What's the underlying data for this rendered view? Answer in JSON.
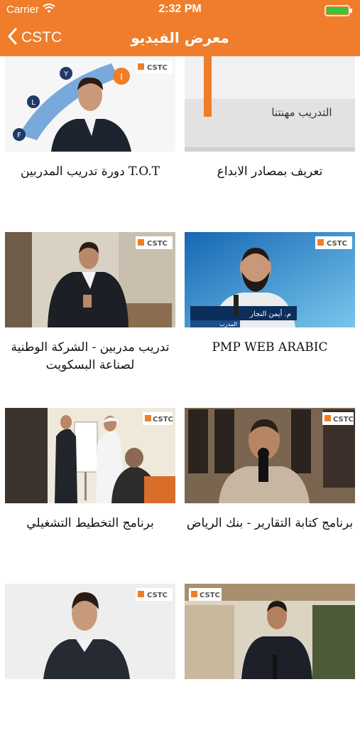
{
  "status_bar": {
    "carrier": "Carrier",
    "time": "2:32 PM"
  },
  "nav": {
    "back_label": "CSTC",
    "title": "معرض الفيديو"
  },
  "thumb_badge": "CSTC",
  "videos": [
    {
      "title": "تعريف بمصادر الابداع",
      "overlay_text": "التدريب مهنتنا"
    },
    {
      "title": "دورة تدريب المدربين T.O.T",
      "overlay_letters": [
        "F",
        "L",
        "Y",
        "I"
      ]
    },
    {
      "title": "PMP WEB ARABIC",
      "lower_third_title": "المدرب",
      "lower_third_name": "م. أيمن النجار"
    },
    {
      "title": "تدريب مدربين - الشركة الوطنية لصناعة البسكويت"
    },
    {
      "title": "برنامج كتابة التقارير - بنك الرياض"
    },
    {
      "title": "برنامج التخطيط التشغيلي"
    },
    {
      "title": ""
    },
    {
      "title": ""
    }
  ],
  "colors": {
    "accent": "#ef7d2b",
    "text": "#111111",
    "background": "#ffffff"
  }
}
